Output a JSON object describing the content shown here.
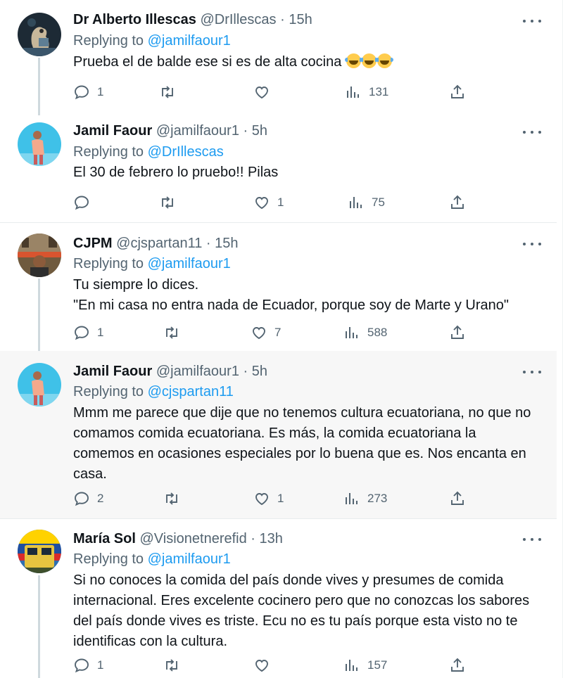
{
  "tweets": [
    {
      "name": "Dr Alberto Illescas",
      "handle": "@DrIllescas",
      "time": "· 15h",
      "replying_label": "Replying to",
      "replying_to": "@jamilfaour1",
      "text": [
        "Prueba el de balde ese si es de alta cocina"
      ],
      "emoji": "😂😂😂",
      "replies": "1",
      "retweets": "",
      "likes": "",
      "views": "131",
      "avatar": "avatar-dr-illescas"
    },
    {
      "name": "Jamil Faour",
      "handle": "@jamilfaour1",
      "time": "· 5h",
      "replying_label": "Replying to",
      "replying_to": "@DrIllescas",
      "text": [
        "El 30 de febrero lo pruebo!! Pilas"
      ],
      "replies": "",
      "retweets": "",
      "likes": "1",
      "views": "75",
      "avatar": "avatar-jamil-faour"
    },
    {
      "name": "CJPM",
      "handle": "@cjspartan11",
      "time": "· 15h",
      "replying_label": "Replying to",
      "replying_to": "@jamilfaour1",
      "text": [
        "Tu siempre lo dices.",
        "\"En mi casa no entra nada de Ecuador, porque soy de Marte y Urano\""
      ],
      "replies": "1",
      "retweets": "",
      "likes": "7",
      "views": "588",
      "avatar": "avatar-cjpm"
    },
    {
      "name": "Jamil Faour",
      "handle": "@jamilfaour1",
      "time": "· 5h",
      "replying_label": "Replying to",
      "replying_to": "@cjspartan11",
      "text": [
        "Mmm me parece que dije que no tenemos cultura ecuatoriana, no que no",
        "comamos comida ecuatoriana. Es más, la comida ecuatoriana la",
        "comemos en ocasiones especiales por lo buena que es. Nos encanta en",
        "casa."
      ],
      "replies": "2",
      "retweets": "",
      "likes": "1",
      "views": "273",
      "avatar": "avatar-jamil-faour"
    },
    {
      "name": "María Sol",
      "handle": "@Visionetnerefid",
      "time": "· 13h",
      "replying_label": "Replying to",
      "replying_to": "@jamilfaour1",
      "text": [
        "Si no conoces la comida del país donde vives y presumes de comida",
        "internacional.  Eres excelente cocinero pero que no conozcas los sabores",
        "del país donde vives es triste. Ecu  no es tu país porque esta visto no te",
        "identificas con la cultura."
      ],
      "replies": "1",
      "retweets": "",
      "likes": "",
      "views": "157",
      "avatar": "avatar-maria-sol"
    }
  ],
  "colors": {
    "text": "#0f1419",
    "secondary": "#536471",
    "link": "#1d9bf0",
    "divider": "#e8ecee",
    "thread_line": "#cfd9de",
    "highlight_bg": "#f7f7f7"
  },
  "icons": {
    "reply": "reply-icon",
    "retweet": "retweet-icon",
    "like": "heart-icon",
    "views": "views-chart-icon",
    "share": "share-icon",
    "more": "more-icon"
  }
}
